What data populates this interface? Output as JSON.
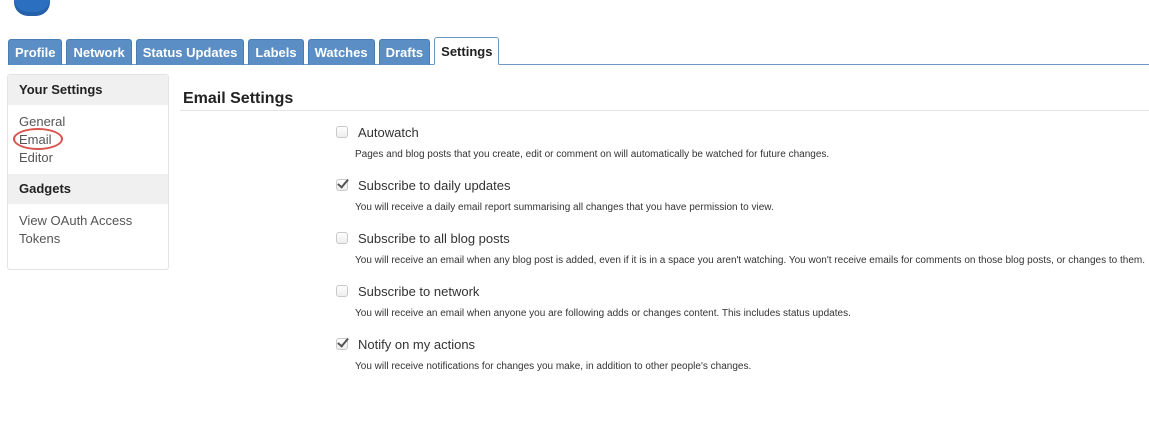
{
  "tabs": [
    {
      "label": "Profile"
    },
    {
      "label": "Network"
    },
    {
      "label": "Status Updates"
    },
    {
      "label": "Labels"
    },
    {
      "label": "Watches"
    },
    {
      "label": "Drafts"
    },
    {
      "label": "Settings",
      "active": true
    }
  ],
  "sidebar": {
    "section1_title": "Your Settings",
    "section1_items": [
      "General",
      "Email",
      "Editor"
    ],
    "section2_title": "Gadgets",
    "section2_items": [
      "View OAuth Access Tokens"
    ]
  },
  "main": {
    "title": "Email Settings",
    "options": [
      {
        "label": "Autowatch",
        "checked": false,
        "description": "Pages and blog posts that you create, edit or comment on will automatically be watched for future changes."
      },
      {
        "label": "Subscribe to daily updates",
        "checked": true,
        "description": "You will receive a daily email report summarising all changes that you have permission to view."
      },
      {
        "label": "Subscribe to all blog posts",
        "checked": false,
        "description": "You will receive an email when any blog post is added, even if it is in a space you aren't watching. You won't receive emails for comments on those blog posts, or changes to them."
      },
      {
        "label": "Subscribe to network",
        "checked": false,
        "description": "You will receive an email when anyone you are following adds or changes content. This includes status updates."
      },
      {
        "label": "Notify on my actions",
        "checked": true,
        "description": "You will receive notifications for changes you make, in addition to other people's changes."
      }
    ]
  },
  "colors": {
    "tab_bg": "#5a8ec4",
    "tab_border": "#6f98c2",
    "highlight_circle": "#d9534f"
  }
}
